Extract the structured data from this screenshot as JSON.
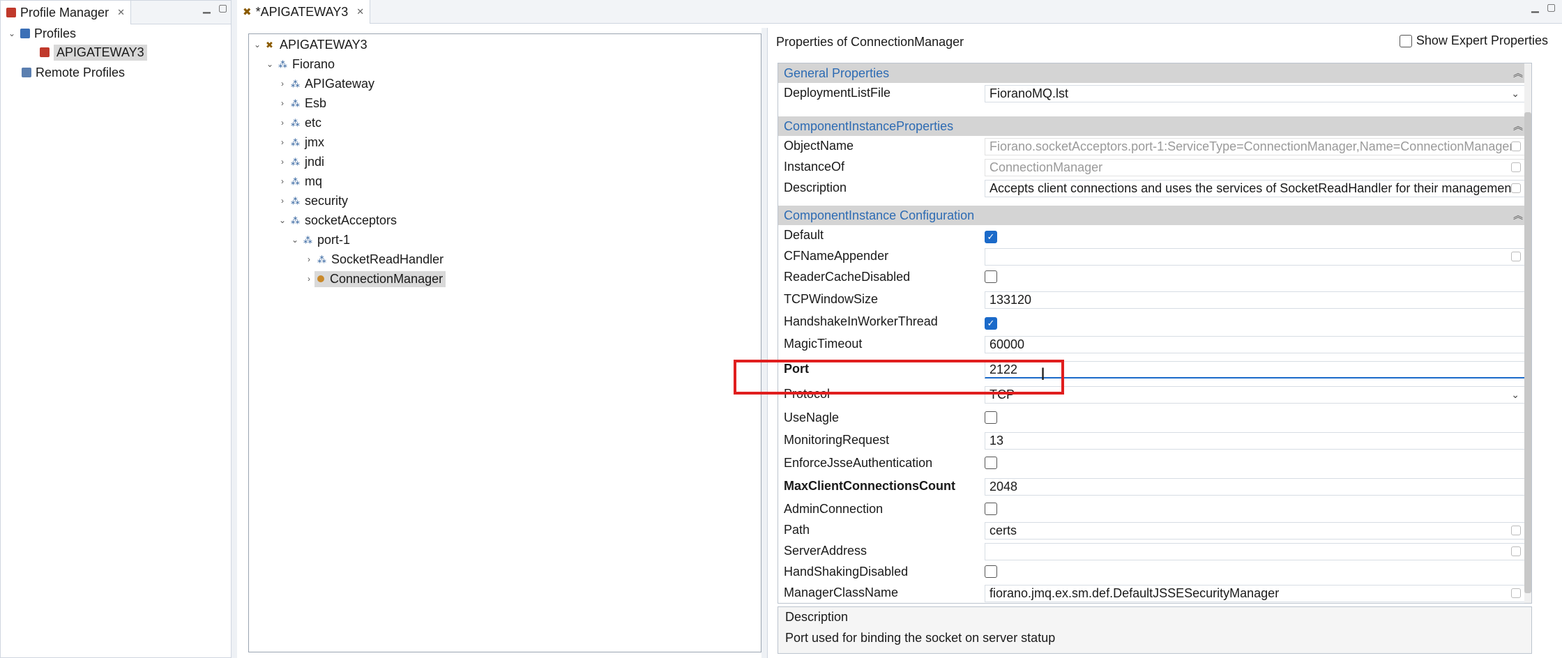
{
  "left_panel": {
    "title": "Profile Manager",
    "tree": [
      {
        "label": "Profiles",
        "icon": "profiles-icon"
      },
      {
        "label": "APIGATEWAY3",
        "icon": "gateway-profile-icon"
      },
      {
        "label": "Remote Profiles",
        "icon": "remote-profiles-icon"
      }
    ]
  },
  "editor": {
    "tab_label": "*APIGATEWAY3",
    "tree": [
      {
        "label": "APIGATEWAY3",
        "depth": 0
      },
      {
        "label": "Fiorano",
        "depth": 1
      },
      {
        "label": "APIGateway",
        "depth": 2
      },
      {
        "label": "Esb",
        "depth": 2
      },
      {
        "label": "etc",
        "depth": 2
      },
      {
        "label": "jmx",
        "depth": 2
      },
      {
        "label": "jndi",
        "depth": 2
      },
      {
        "label": "mq",
        "depth": 2
      },
      {
        "label": "security",
        "depth": 2
      },
      {
        "label": "socketAcceptors",
        "depth": 2
      },
      {
        "label": "port-1",
        "depth": 3
      },
      {
        "label": "SocketReadHandler",
        "depth": 4
      },
      {
        "label": "ConnectionManager",
        "depth": 4,
        "selected": true
      }
    ]
  },
  "properties": {
    "title": "Properties of ConnectionManager",
    "show_expert_label": "Show Expert Properties",
    "show_expert_checked": false,
    "sections": {
      "general": "General Properties",
      "component_instance": "ComponentInstanceProperties",
      "component_config": "ComponentInstance Configuration"
    },
    "general": {
      "deployment_list_file_key": "DeploymentListFile",
      "deployment_list_file_value": "FioranoMQ.lst"
    },
    "instance": {
      "object_name_key": "ObjectName",
      "object_name_value": "Fiorano.socketAcceptors.port-1:ServiceType=ConnectionManager,Name=ConnectionManager",
      "instance_of_key": "InstanceOf",
      "instance_of_value": "ConnectionManager",
      "description_key": "Description",
      "description_value": "Accepts client connections and uses the services of SocketReadHandler for their management"
    },
    "config": {
      "default_key": "Default",
      "default_checked": true,
      "cfname_key": "CFNameAppender",
      "cfname_value": "",
      "reader_cache_key": "ReaderCacheDisabled",
      "reader_cache_checked": false,
      "tcp_window_key": "TCPWindowSize",
      "tcp_window_value": "133120",
      "handshake_worker_key": "HandshakeInWorkerThread",
      "handshake_worker_checked": true,
      "magic_timeout_key": "MagicTimeout",
      "magic_timeout_value": "60000",
      "port_key": "Port",
      "port_value": "2122",
      "protocol_key": "Protocol",
      "protocol_value": "TCP",
      "use_nagle_key": "UseNagle",
      "use_nagle_checked": false,
      "monitoring_key": "MonitoringRequest",
      "monitoring_value": "13",
      "enforce_jsse_key": "EnforceJsseAuthentication",
      "enforce_jsse_checked": false,
      "max_client_key": "MaxClientConnectionsCount",
      "max_client_value": "2048",
      "admin_conn_key": "AdminConnection",
      "admin_conn_checked": false,
      "path_key": "Path",
      "path_value": "certs",
      "server_address_key": "ServerAddress",
      "server_address_value": "",
      "handshaking_disabled_key": "HandShakingDisabled",
      "handshaking_disabled_checked": false,
      "manager_class_key": "ManagerClassName",
      "manager_class_value": "fiorano.jmq.ex.sm.def.DefaultJSSESecurityManager"
    },
    "description_box": {
      "title": "Description",
      "text": "Port used for binding the socket on server statup"
    }
  },
  "colors": {
    "accent": "#1b6ac9",
    "highlight_box": "#e01e1e",
    "section_text": "#2d6bb3",
    "section_bg": "#d4d4d4"
  }
}
